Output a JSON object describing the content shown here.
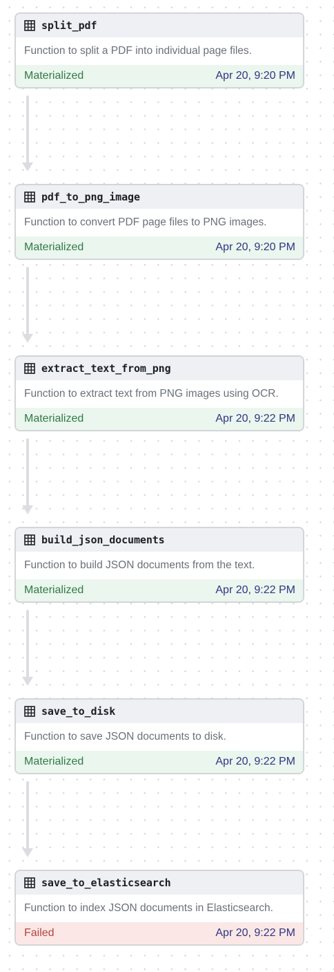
{
  "colors": {
    "materialized_text": "#2f7b45",
    "materialized_bg": "#ebf6ee",
    "failed_text": "#b2463d",
    "failed_bg": "#fbe8e6",
    "timestamp_text": "#2e3585",
    "edge": "#dcdde1"
  },
  "icon": "table-icon",
  "nodes": [
    {
      "name": "split_pdf",
      "description": "Function to split a PDF into individual page files.",
      "status": "Materialized",
      "timestamp": "Apr 20, 9:20 PM"
    },
    {
      "name": "pdf_to_png_image",
      "description": "Function to convert PDF page files to PNG images.",
      "status": "Materialized",
      "timestamp": "Apr 20, 9:20 PM"
    },
    {
      "name": "extract_text_from_png",
      "description": "Function to extract text from PNG images using OCR.",
      "status": "Materialized",
      "timestamp": "Apr 20, 9:22 PM"
    },
    {
      "name": "build_json_documents",
      "description": "Function to build JSON documents from the text.",
      "status": "Materialized",
      "timestamp": "Apr 20, 9:22 PM"
    },
    {
      "name": "save_to_disk",
      "description": "Function to save JSON documents to disk.",
      "status": "Materialized",
      "timestamp": "Apr 20, 9:22 PM"
    },
    {
      "name": "save_to_elasticsearch",
      "description": "Function to index JSON documents in Elasticsearch.",
      "status": "Failed",
      "timestamp": "Apr 20, 9:22 PM"
    }
  ]
}
